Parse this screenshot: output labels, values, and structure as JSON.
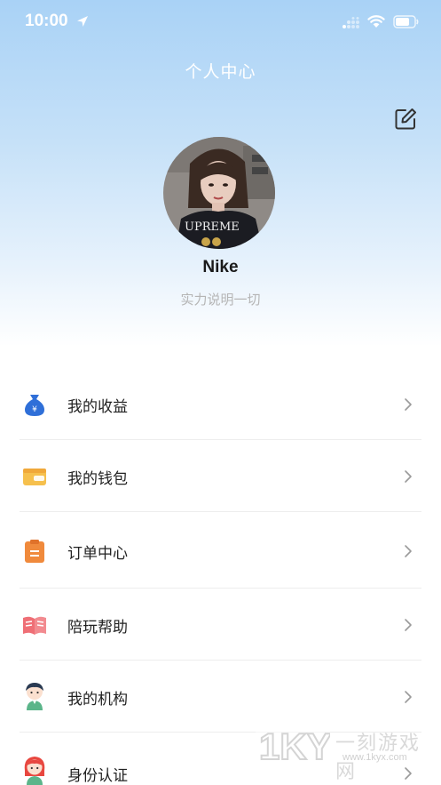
{
  "status_bar": {
    "time": "10:00",
    "icons": [
      "location-arrow-icon",
      "signal-icon",
      "wifi-icon",
      "battery-icon"
    ]
  },
  "header": {
    "title": "个人中心",
    "edit_icon": "edit-icon"
  },
  "profile": {
    "name": "Nike",
    "bio": "实力说明一切",
    "avatar_shirt_text": "UPREME"
  },
  "menu": {
    "items": [
      {
        "label": "我的收益",
        "icon": "money-bag-icon"
      },
      {
        "label": "我的钱包",
        "icon": "wallet-icon"
      },
      {
        "label": "订单中心",
        "icon": "order-clipboard-icon"
      },
      {
        "label": "陪玩帮助",
        "icon": "help-book-icon"
      },
      {
        "label": "我的机构",
        "icon": "organization-person-icon"
      },
      {
        "label": "身份认证",
        "icon": "identity-person-icon"
      }
    ]
  },
  "watermark": {
    "logo": "1KYX",
    "text": "一刻游戏网",
    "url": "www.1kyx.com"
  },
  "colors": {
    "header_gradient_top": "#a9d2f6",
    "background": "#ffffff",
    "bio_text": "#b5b5b5",
    "divider": "#ededed"
  }
}
